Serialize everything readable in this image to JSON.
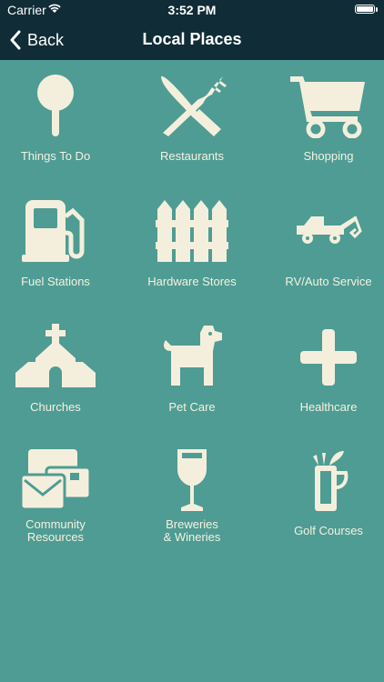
{
  "status_bar": {
    "carrier": "Carrier",
    "time": "3:52 PM"
  },
  "nav": {
    "back_label": "Back",
    "title": "Local Places"
  },
  "tiles": [
    {
      "label": "Things To Do",
      "icon": "map-pin-icon"
    },
    {
      "label": "Restaurants",
      "icon": "fork-knife-icon"
    },
    {
      "label": "Shopping",
      "icon": "shopping-cart-icon"
    },
    {
      "label": "Fuel Stations",
      "icon": "fuel-pump-icon"
    },
    {
      "label": "Hardware Stores",
      "icon": "fence-icon"
    },
    {
      "label": "RV/Auto Service",
      "icon": "tow-truck-icon"
    },
    {
      "label": "Churches",
      "icon": "church-icon"
    },
    {
      "label": "Pet Care",
      "icon": "dog-icon"
    },
    {
      "label": "Healthcare",
      "icon": "plus-icon"
    },
    {
      "label": "Community\nResources",
      "icon": "mail-cards-icon"
    },
    {
      "label": "Breweries\n& Wineries",
      "icon": "wine-glass-icon"
    },
    {
      "label": "Golf Courses",
      "icon": "golf-bag-icon"
    }
  ],
  "colors": {
    "background": "#4e9c94",
    "bar": "#102c36",
    "icon": "#f4efdc"
  }
}
